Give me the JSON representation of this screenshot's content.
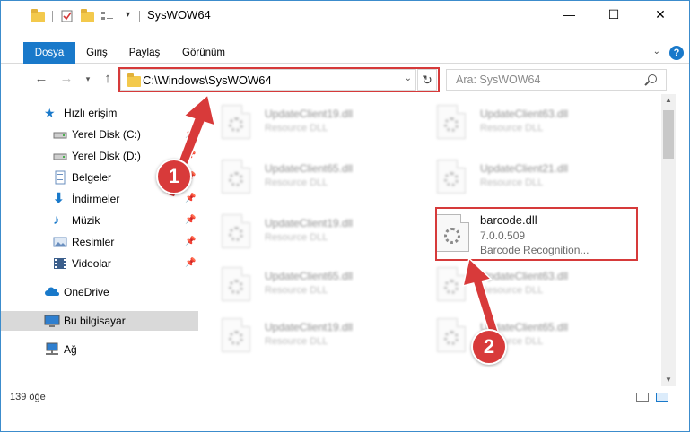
{
  "window": {
    "title": "SysWOW64",
    "minimize_glyph": "—",
    "maximize_glyph": "☐",
    "close_glyph": "✕",
    "accent_color": "#1979ca",
    "highlight_color": "#d63a3a"
  },
  "ribbon": {
    "tabs": [
      {
        "label": "Dosya",
        "active": true
      },
      {
        "label": "Giriş"
      },
      {
        "label": "Paylaş"
      },
      {
        "label": "Görünüm"
      }
    ],
    "help_label": "?"
  },
  "navigation": {
    "back_icon": "arrow-left-icon",
    "forward_icon": "arrow-right-icon",
    "recent_icon": "chevron-down-icon",
    "up_icon": "arrow-up-icon",
    "address_path": "C:\\Windows\\SysWOW64",
    "refresh_icon": "refresh-icon",
    "search_placeholder": "Ara: SysWOW64"
  },
  "sidebar": {
    "items": [
      {
        "label": "Hızlı erişim",
        "icon": "star-icon"
      },
      {
        "label": "Yerel Disk (C:)",
        "icon": "drive-icon",
        "pinned": true
      },
      {
        "label": "Yerel Disk (D:)",
        "icon": "drive-icon",
        "pinned": true
      },
      {
        "label": "Belgeler",
        "icon": "document-icon",
        "pinned": true
      },
      {
        "label": "İndirmeler",
        "icon": "download-icon",
        "pinned": true
      },
      {
        "label": "Müzik",
        "icon": "music-icon",
        "pinned": true
      },
      {
        "label": "Resimler",
        "icon": "picture-icon",
        "pinned": true
      },
      {
        "label": "Videolar",
        "icon": "video-icon",
        "pinned": true
      },
      {
        "label": "OneDrive",
        "icon": "cloud-icon"
      },
      {
        "label": "Bu bilgisayar",
        "icon": "computer-icon",
        "selected": true
      },
      {
        "label": "Ağ",
        "icon": "network-icon"
      }
    ]
  },
  "files": [
    {
      "name": "UpdateClient19.dll",
      "type": "Resource DLL"
    },
    {
      "name": "UpdateClient63.dll",
      "type": "Resource DLL"
    },
    {
      "name": "UpdateClient65.dll",
      "type": "Resource DLL"
    },
    {
      "name": "UpdateClient21.dll",
      "type": "Resource DLL"
    },
    {
      "name": "UpdateClient19.dll",
      "type": "Resource DLL"
    },
    {
      "name": "barcode.dll",
      "version": "7.0.0.509",
      "description": "Barcode Recognition...",
      "highlighted": true
    },
    {
      "name": "UpdateClient65.dll",
      "type": "Resource DLL"
    },
    {
      "name": "UpdateClient63.dll",
      "type": "Resource DLL"
    },
    {
      "name": "UpdateClient19.dll",
      "type": "Resource DLL"
    },
    {
      "name": "UpdateClient65.dll",
      "type": "Resource DLL"
    }
  ],
  "status": {
    "item_count": "139 öğe"
  },
  "annotations": [
    {
      "number": "1"
    },
    {
      "number": "2"
    }
  ]
}
